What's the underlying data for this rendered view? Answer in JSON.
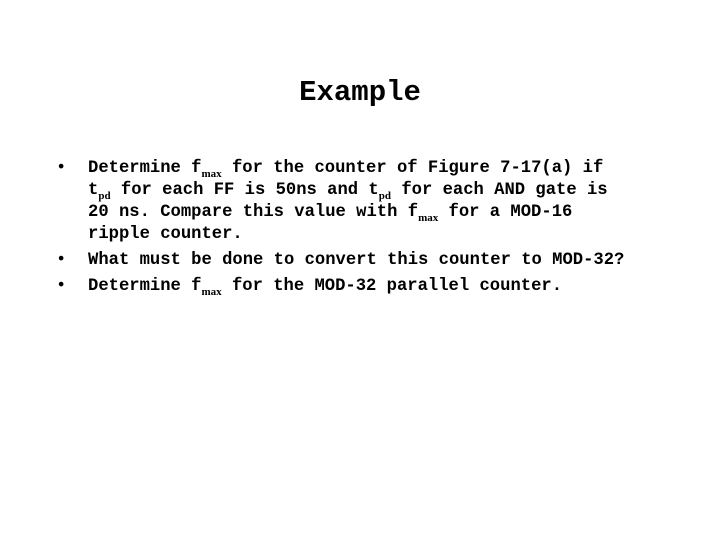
{
  "slide": {
    "title": "Example",
    "bullet_glyph": "•",
    "bullets": [
      {
        "lines": [
          {
            "a": "Determine f",
            "sub": "max",
            "b": " for the counter of Figure 7-17(a) if"
          },
          {
            "a": "t",
            "sub": "pd",
            "b": " for each FF is 50ns and t",
            "sub2": "pd",
            "c": " for each AND gate is"
          },
          {
            "a": "20 ns. Compare this value with f",
            "sub": "max",
            "b": " for a MOD-16"
          },
          {
            "a": "ripple counter."
          }
        ]
      },
      {
        "lines": [
          {
            "a": "What must be done to convert this counter to MOD-32?"
          }
        ]
      },
      {
        "lines": [
          {
            "a": "Determine f",
            "sub": "max",
            "b": " for the MOD-32 parallel counter."
          }
        ]
      }
    ]
  }
}
